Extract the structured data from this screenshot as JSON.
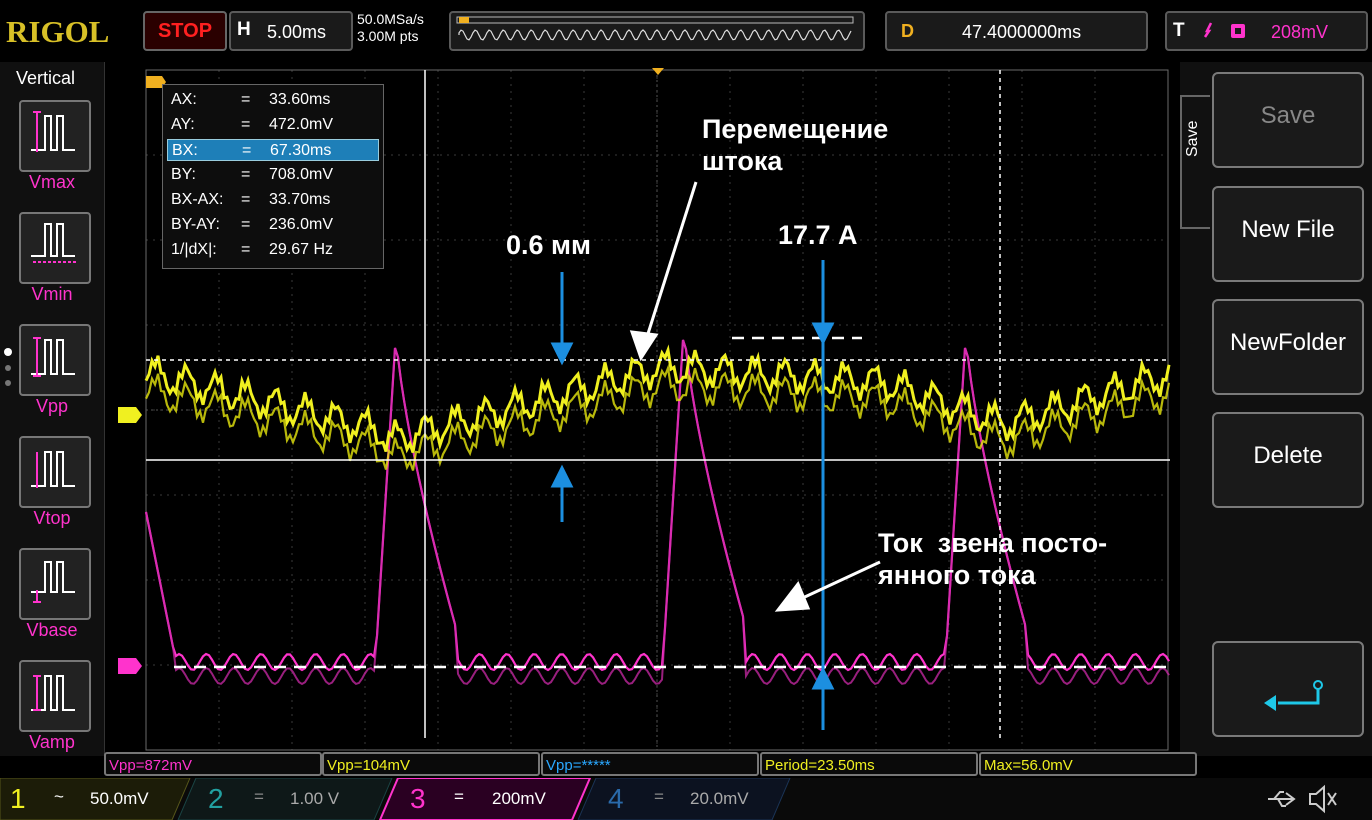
{
  "header": {
    "brand": "RIGOL",
    "run_state": "STOP",
    "timebase_key": "H",
    "timebase_value": "5.00ms",
    "sample_rate": "50.0MSa/s",
    "memory_depth": "3.00M pts",
    "delay_key": "D",
    "delay_value": "47.4000000ms",
    "trigger_key": "T",
    "trigger_level": "208mV"
  },
  "left_menu": {
    "title": "Vertical",
    "items": [
      {
        "label": "Vmax"
      },
      {
        "label": "Vmin"
      },
      {
        "label": "Vpp"
      },
      {
        "label": "Vtop"
      },
      {
        "label": "Vbase"
      },
      {
        "label": "Vamp"
      }
    ]
  },
  "right_menu": {
    "tab_label": "Save",
    "items": [
      {
        "label": "Save"
      },
      {
        "label": "New File"
      },
      {
        "label": "NewFolder"
      },
      {
        "label": "Delete"
      }
    ]
  },
  "cursors": {
    "rows": [
      {
        "name": "AX:",
        "eq": "=",
        "value": "33.60ms"
      },
      {
        "name": "AY:",
        "eq": "=",
        "value": "472.0mV"
      },
      {
        "name": "BX:",
        "eq": "=",
        "value": "67.30ms"
      },
      {
        "name": "BY:",
        "eq": "=",
        "value": "708.0mV"
      },
      {
        "name": "BX-AX:",
        "eq": "=",
        "value": "33.70ms"
      },
      {
        "name": "BY-AY:",
        "eq": "=",
        "value": "236.0mV"
      },
      {
        "name": "1/|dX|:",
        "eq": "=",
        "value": "29.67 Hz"
      }
    ]
  },
  "annotations": {
    "displacement": "Перемещение\nштока",
    "stroke": "0.6 мм",
    "current_peak": "17.7 А",
    "dc_link": "Ток  звена посто-\nянного тока"
  },
  "measurements": [
    {
      "text": "Vpp=872mV",
      "color": "#ff33cc"
    },
    {
      "text": "Vpp=104mV",
      "color": "#f0f020"
    },
    {
      "text": "Vpp=*****",
      "color": "#2aa8ff"
    },
    {
      "text": "Period=23.50ms",
      "color": "#f0f020"
    },
    {
      "text": "Max=56.0mV",
      "color": "#f0f020"
    }
  ],
  "channels": [
    {
      "num": "1",
      "coupling": "~",
      "scale": "50.0mV",
      "color": "#f0f020"
    },
    {
      "num": "2",
      "coupling": "=",
      "scale": "1.00 V",
      "color": "#22b0b0"
    },
    {
      "num": "3",
      "coupling": "=",
      "scale": "200mV",
      "color": "#ff33cc"
    },
    {
      "num": "4",
      "coupling": "=",
      "scale": "20.0mV",
      "color": "#2a7acc"
    }
  ],
  "colors": {
    "ch1": "#f0f020",
    "ch3": "#ff33cc",
    "annotation_arrow": "#1c8fe0",
    "brand": "#d8c027"
  },
  "icons": {
    "usb": "usb-icon",
    "mute": "speaker-mute-icon",
    "enter": "enter-arrow-icon"
  }
}
